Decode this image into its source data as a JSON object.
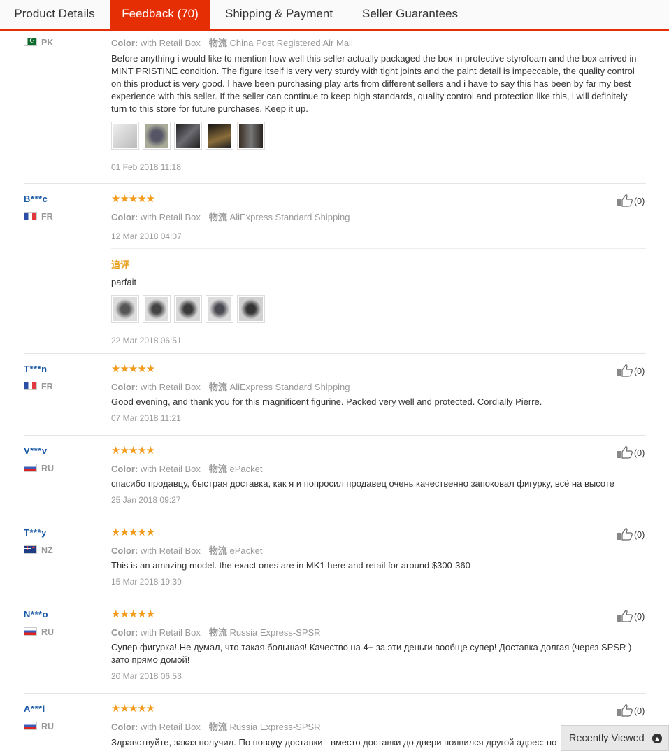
{
  "tabs": [
    {
      "label": "Product Details"
    },
    {
      "label": "Feedback (70)"
    },
    {
      "label": "Shipping & Payment"
    },
    {
      "label": "Seller Guarantees"
    }
  ],
  "labels": {
    "color_label": "Color:",
    "logistics_label": "物流",
    "additional_feedback": "追评",
    "stars": "★★★★★",
    "recently_viewed": "Recently Viewed"
  },
  "reviews": [
    {
      "user": "",
      "country": "PK",
      "color": "with Retail Box",
      "shipping": "China Post Registered Air Mail",
      "text": "Before anything i would like to mention how well this seller actually packaged the box in protective styrofoam and the box arrived in MINT PRISTINE condition. The figure itself is very very sturdy with tight joints and the paint detail is impeccable, the quality control on this product is very good. I have been purchasing play arts from different sellers and i have to say this has been by far my best experience with this seller. If the seller can continue to keep high standards, quality control and protection like this, i will definitely turn to this store for future purchases. Keep it up.",
      "date": "01 Feb 2018 11:18"
    },
    {
      "user": "B***c",
      "country": "FR",
      "color": "with Retail Box",
      "shipping": "AliExpress Standard Shipping",
      "date": "12 Mar 2018 04:07",
      "likes": "(0)",
      "followup_text": "parfait",
      "followup_date": "22 Mar 2018 06:51"
    },
    {
      "user": "T***n",
      "country": "FR",
      "color": "with Retail Box",
      "shipping": "AliExpress Standard Shipping",
      "text": "Good evening, and thank you for this magnificent figurine. Packed very well and protected. Cordially Pierre.",
      "date": "07 Mar 2018 11:21",
      "likes": "(0)"
    },
    {
      "user": "V***v",
      "country": "RU",
      "color": "with Retail Box",
      "shipping": "ePacket",
      "text": "спасибо продавцу, быстрая доставка, как я и попросил продавец очень качественно запоковал фигурку, всё на высоте",
      "date": "25 Jan 2018 09:27",
      "likes": "(0)"
    },
    {
      "user": "T***y",
      "country": "NZ",
      "color": "with Retail Box",
      "shipping": "ePacket",
      "text": "This is an amazing model. the exact ones are in MK1 here and retail for around $300-360",
      "date": "15 Mar 2018 19:39",
      "likes": "(0)"
    },
    {
      "user": "N***o",
      "country": "RU",
      "color": "with Retail Box",
      "shipping": "Russia Express-SPSR",
      "text": "Супер фигурка! Не думал, что такая большая! Качество на 4+ за эти деньги вообще супер! Доставка долгая (через SPSR ) зато прямо домой!",
      "date": "20 Mar 2018 06:53",
      "likes": "(0)"
    },
    {
      "user": "A***l",
      "country": "RU",
      "color": "with Retail Box",
      "shipping": "Russia Express-SPSR",
      "text": "Здравствуйте, заказ получил. По поводу доставки - вместо доставки до двери появился другой адрес: по",
      "likes": "(0)"
    }
  ],
  "colors": {
    "accent": "#e62e04",
    "star": "#f29a1a",
    "username": "#1a5aa7",
    "followup": "#e8a21f"
  }
}
